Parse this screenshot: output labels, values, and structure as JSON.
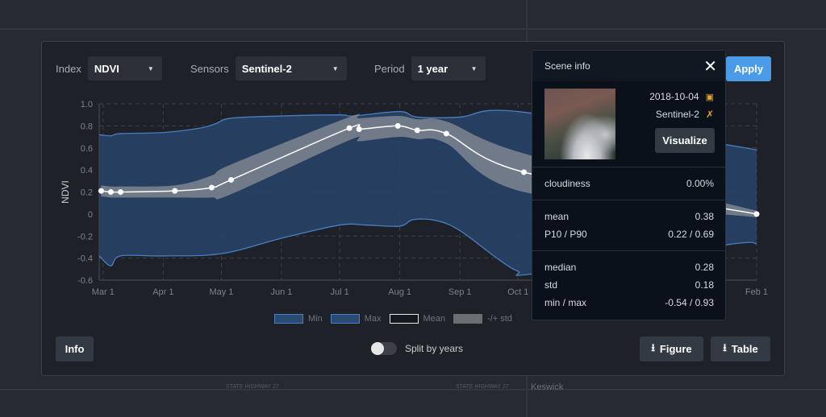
{
  "map": {
    "labels": [
      "STATE HIGHWAY 27",
      "STATE HIGHWAY 27",
      "Keswick"
    ]
  },
  "controls": {
    "index": {
      "label": "Index",
      "value": "NDVI"
    },
    "sensors": {
      "label": "Sensors",
      "value": "Sentinel-2"
    },
    "period": {
      "label": "Period",
      "value": "1 year"
    },
    "apply": "Apply"
  },
  "chart_data": {
    "type": "line",
    "ylabel": "NDVI",
    "ylim": [
      -0.6,
      1.0
    ],
    "yticks": [
      "1.0",
      "0.8",
      "0.6",
      "0.4",
      "0.2",
      "0",
      "-0.2",
      "-0.4",
      "-0.6"
    ],
    "xlim": [
      "2018-02-27",
      "2019-02-01"
    ],
    "xticks": [
      {
        "date": "2018-03-01",
        "label": "Mar 1"
      },
      {
        "date": "2018-04-01",
        "label": "Apr 1"
      },
      {
        "date": "2018-05-01",
        "label": "May 1"
      },
      {
        "date": "2018-06-01",
        "label": "Jun 1"
      },
      {
        "date": "2018-07-01",
        "label": "Jul 1"
      },
      {
        "date": "2018-08-01",
        "label": "Aug 1"
      },
      {
        "date": "2018-09-01",
        "label": "Sep 1"
      },
      {
        "date": "2018-10-01",
        "label": "Oct 1"
      },
      {
        "date": "2019-02-01",
        "label": "Feb 1"
      }
    ],
    "grid": true,
    "legend": [
      {
        "name": "Min",
        "color": "#2f5688"
      },
      {
        "name": "Max",
        "color": "#2f5688"
      },
      {
        "name": "Mean",
        "color": "#ffffff"
      },
      {
        "name": "-/+ std",
        "color": "#6b6e73"
      }
    ],
    "max": [
      [
        "2018-02-27",
        0.72
      ],
      [
        "2018-03-05",
        0.71
      ],
      [
        "2018-03-10",
        0.73
      ],
      [
        "2018-04-01",
        0.74
      ],
      [
        "2018-04-20",
        0.78
      ],
      [
        "2018-04-28",
        0.82
      ],
      [
        "2018-05-06",
        0.87
      ],
      [
        "2018-06-01",
        0.89
      ],
      [
        "2018-07-01",
        0.9
      ],
      [
        "2018-07-08",
        0.89
      ],
      [
        "2018-08-01",
        0.93
      ],
      [
        "2018-08-10",
        0.88
      ],
      [
        "2018-09-01",
        0.88
      ],
      [
        "2018-10-01",
        0.93
      ],
      [
        "2019-01-16",
        0.63
      ],
      [
        "2019-02-01",
        0.58
      ]
    ],
    "min": [
      [
        "2018-02-27",
        -0.38
      ],
      [
        "2018-03-05",
        -0.47
      ],
      [
        "2018-03-10",
        -0.38
      ],
      [
        "2018-04-01",
        -0.38
      ],
      [
        "2018-05-01",
        -0.36
      ],
      [
        "2018-06-01",
        -0.22
      ],
      [
        "2018-07-01",
        -0.1
      ],
      [
        "2018-07-15",
        -0.1
      ],
      [
        "2018-08-01",
        -0.11
      ],
      [
        "2018-08-08",
        -0.05
      ],
      [
        "2018-08-20",
        -0.06
      ],
      [
        "2018-09-01",
        -0.15
      ],
      [
        "2018-09-20",
        -0.4
      ],
      [
        "2018-10-01",
        -0.52
      ],
      [
        "2018-10-10",
        -0.54
      ],
      [
        "2019-01-16",
        -0.28
      ],
      [
        "2019-02-01",
        -0.27
      ]
    ],
    "mean": [
      [
        "2018-02-28",
        0.21,
        0.26,
        0.16
      ],
      [
        "2018-03-05",
        0.2,
        0.25,
        0.15
      ],
      [
        "2018-03-10",
        0.2,
        0.25,
        0.15
      ],
      [
        "2018-04-07",
        0.21,
        0.26,
        0.15
      ],
      [
        "2018-04-26",
        0.24,
        0.35,
        0.15
      ],
      [
        "2018-05-06",
        0.31,
        0.45,
        0.18
      ],
      [
        "2018-07-06",
        0.78,
        0.88,
        0.67
      ],
      [
        "2018-07-11",
        0.77,
        0.87,
        0.66
      ],
      [
        "2018-07-31",
        0.8,
        0.89,
        0.7
      ],
      [
        "2018-08-10",
        0.76,
        0.86,
        0.68
      ],
      [
        "2018-08-25",
        0.73,
        0.84,
        0.64
      ],
      [
        "2018-10-04",
        0.38,
        0.55,
        0.2
      ],
      [
        "2019-02-01",
        0.0,
        0.03,
        -0.03
      ]
    ]
  },
  "bottom": {
    "info": "Info",
    "split": "Split by years",
    "split_on": false,
    "figure": "Figure",
    "table": "Table"
  },
  "scene": {
    "title": "Scene info",
    "date": "2018-10-04",
    "sensor": "Sentinel-2",
    "visualize": "Visualize",
    "accent": "#f0a020",
    "rows": [
      [
        {
          "k": "cloudiness",
          "v": "0.00%"
        }
      ],
      [
        {
          "k": "mean",
          "v": "0.38"
        },
        {
          "k": "P10 / P90",
          "v": "0.22 / 0.69"
        }
      ],
      [
        {
          "k": "median",
          "v": "0.28"
        },
        {
          "k": "std",
          "v": "0.18"
        },
        {
          "k": "min / max",
          "v": "-0.54 / 0.93"
        }
      ]
    ]
  }
}
